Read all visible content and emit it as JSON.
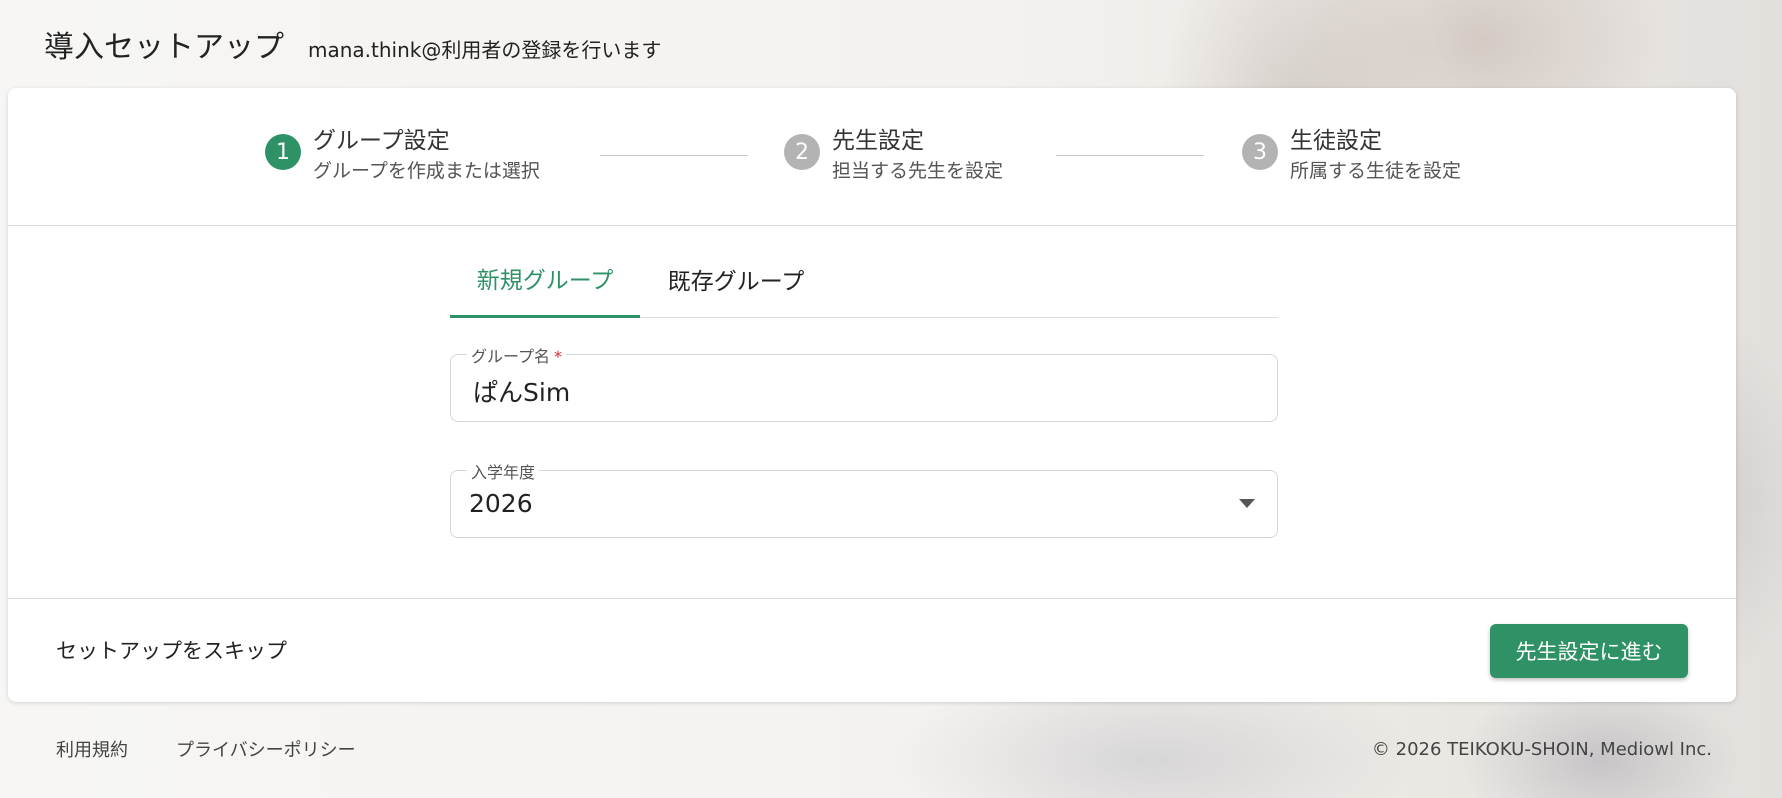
{
  "header": {
    "title": "導入セットアップ",
    "subtitle": "mana.think@利用者の登録を行います"
  },
  "stepper": {
    "steps": [
      {
        "number": "1",
        "name": "グループ設定",
        "desc": "グループを作成または選択",
        "status": "active"
      },
      {
        "number": "2",
        "name": "先生設定",
        "desc": "担当する先生を設定",
        "status": "inactive"
      },
      {
        "number": "3",
        "name": "生徒設定",
        "desc": "所属する生徒を設定",
        "status": "inactive"
      }
    ]
  },
  "tabs": [
    {
      "label": "新規グループ",
      "active": true
    },
    {
      "label": "既存グループ",
      "active": false
    }
  ],
  "form": {
    "group_name_label": "グループ名",
    "group_name_required": "*",
    "group_name_value": "ぱんSim",
    "year_label": "入学年度",
    "year_value": "2026"
  },
  "actions": {
    "skip_label": "セットアップをスキップ",
    "next_label": "先生設定に進む"
  },
  "footer": {
    "terms": "利用規約",
    "privacy": "プライバシーポリシー",
    "copyright": "© 2026 TEIKOKU-SHOIN, Mediowl Inc."
  },
  "colors": {
    "accent": "#2e9266",
    "inactive_step": "#b3b3b3",
    "required": "#d32f2f"
  }
}
